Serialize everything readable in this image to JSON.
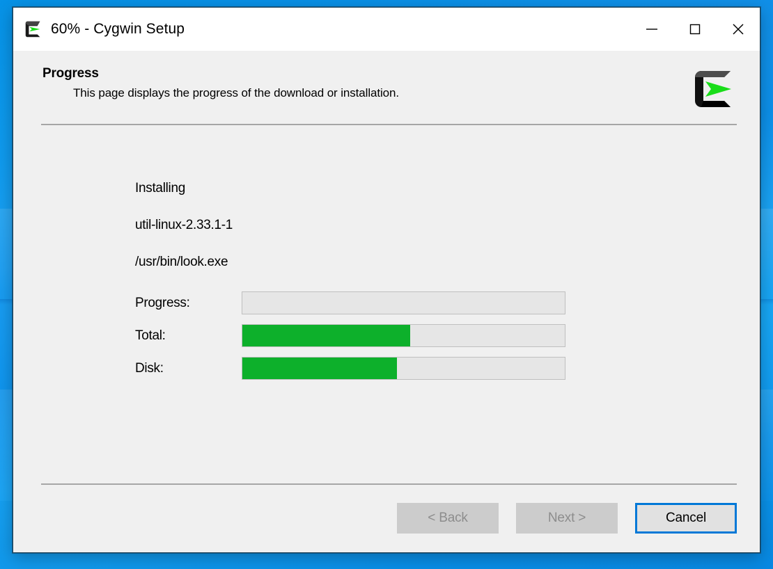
{
  "window": {
    "title": "60% - Cygwin Setup",
    "app_icon": "cygwin-logo-icon",
    "controls": {
      "minimize": "minimize-icon",
      "maximize": "maximize-icon",
      "close": "close-icon"
    }
  },
  "header": {
    "title": "Progress",
    "subtitle": "This page displays the progress of the download or installation.",
    "logo": "cygwin-logo-icon"
  },
  "status": {
    "action": "Installing",
    "package": "util-linux-2.33.1-1",
    "file": "/usr/bin/look.exe"
  },
  "bars": [
    {
      "label": "Progress:",
      "percent": 0
    },
    {
      "label": "Total:",
      "percent": 52
    },
    {
      "label": "Disk:",
      "percent": 48
    }
  ],
  "buttons": {
    "back": "< Back",
    "next": "Next >",
    "cancel": "Cancel"
  },
  "colors": {
    "progress_green": "#0db02b",
    "track_gray": "#e6e6e6",
    "accent_blue": "#0078d7",
    "window_chrome": "#f0f0f0"
  }
}
